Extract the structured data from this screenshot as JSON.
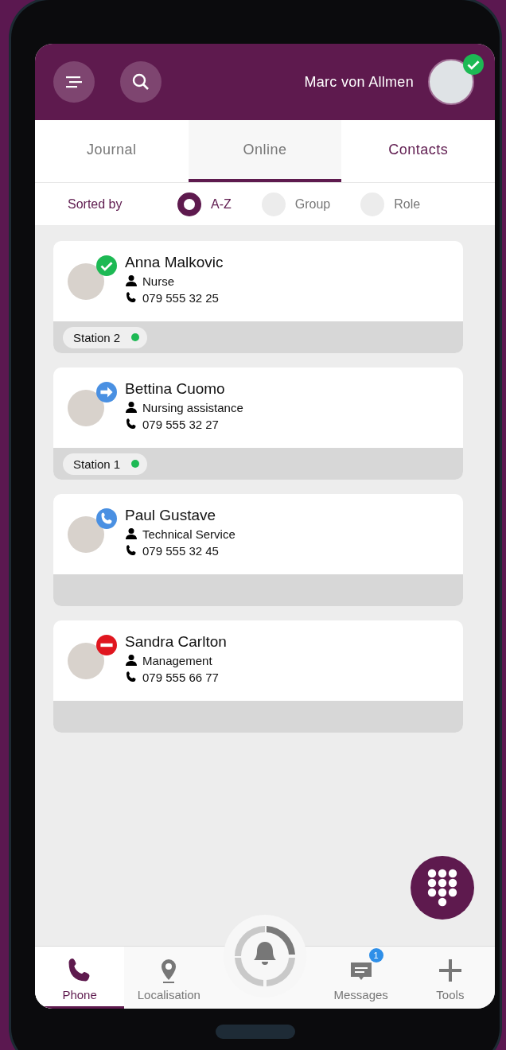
{
  "header": {
    "user_name": "Marc von Allmen",
    "user_status": {
      "kind": "available"
    }
  },
  "tabs": [
    {
      "label": "Journal",
      "selected": false,
      "emphasized": false
    },
    {
      "label": "Online",
      "selected": true,
      "emphasized": false
    },
    {
      "label": "Contacts",
      "selected": false,
      "emphasized": true
    }
  ],
  "sort": {
    "label": "Sorted by",
    "options": [
      {
        "label": "A-Z",
        "selected": true
      },
      {
        "label": "Group",
        "selected": false
      },
      {
        "label": "Role",
        "selected": false
      }
    ]
  },
  "contacts": [
    {
      "name": "Anna Malkovic",
      "role": "Nurse",
      "phone": "079 555 32 25",
      "status": {
        "kind": "available"
      },
      "station": {
        "label": "Station 2",
        "color": "#1db954"
      }
    },
    {
      "name": "Bettina Cuomo",
      "role": "Nursing assistance",
      "phone": "079 555 32 27",
      "status": {
        "kind": "forwarded"
      },
      "station": {
        "label": "Station 1",
        "color": "#1db954"
      }
    },
    {
      "name": "Paul Gustave",
      "role": "Technical Service",
      "phone": "079 555 32 45",
      "status": {
        "kind": "on_call"
      }
    },
    {
      "name": "Sandra Carlton",
      "role": "Management",
      "phone": "079 555 66 77",
      "status": {
        "kind": "busy"
      }
    }
  ],
  "nav": [
    {
      "kind": "phone",
      "label": "Phone",
      "selected": true
    },
    {
      "kind": "location",
      "label": "Localisation",
      "selected": false
    },
    {
      "kind": "alarm"
    },
    {
      "kind": "messages",
      "label": "Messages",
      "selected": false,
      "badge": "1"
    },
    {
      "kind": "tools",
      "label": "Tools",
      "selected": false
    }
  ]
}
